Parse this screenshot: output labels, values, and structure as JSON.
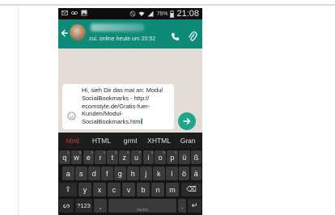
{
  "status_bar": {
    "battery_percent": "76%",
    "time": "21:08"
  },
  "header": {
    "last_seen": "zul. online heute um 20:52"
  },
  "composer": {
    "message_text": "Hi, sieh Dir das mal an: Modul\nSocialBookmarks - http://\necomstyle.de/Gratis-fuer-\nKunden/Modul-\nSocialBookmarks.html"
  },
  "suggestions": [
    "html",
    "HTML",
    "grml",
    "XHTML",
    "Gran"
  ],
  "keyboard": {
    "row1": [
      {
        "label": "q",
        "hint": "1"
      },
      {
        "label": "w",
        "hint": "2"
      },
      {
        "label": "e",
        "hint": "3"
      },
      {
        "label": "r",
        "hint": "4"
      },
      {
        "label": "t",
        "hint": "5"
      },
      {
        "label": "z",
        "hint": "6"
      },
      {
        "label": "u",
        "hint": "7"
      },
      {
        "label": "i",
        "hint": "8"
      },
      {
        "label": "o",
        "hint": "9"
      },
      {
        "label": "p",
        "hint": "0"
      },
      {
        "label": "ü",
        "hint": ""
      },
      {
        "label": "ß",
        "hint": ""
      }
    ],
    "row2": [
      "a",
      "s",
      "d",
      "f",
      "g",
      "h",
      "j",
      "k",
      "l",
      "ö",
      "ä"
    ],
    "row3": [
      "y",
      "x",
      "c",
      "v",
      "b",
      "n",
      "m"
    ],
    "row3_shift": "⇧",
    "row3_backspace": "⌫",
    "row4": {
      "swype_key": "ᔕ",
      "sym_key": "?123",
      "comma": ",",
      "space_sub": "DE/EN",
      "period": ".",
      "enter": "↵"
    }
  },
  "colors": {
    "accent": "#0e8a78",
    "send": "#1ea58d",
    "chat_bg": "#e3ddd5",
    "suggestion_highlight": "#e03a3a"
  }
}
